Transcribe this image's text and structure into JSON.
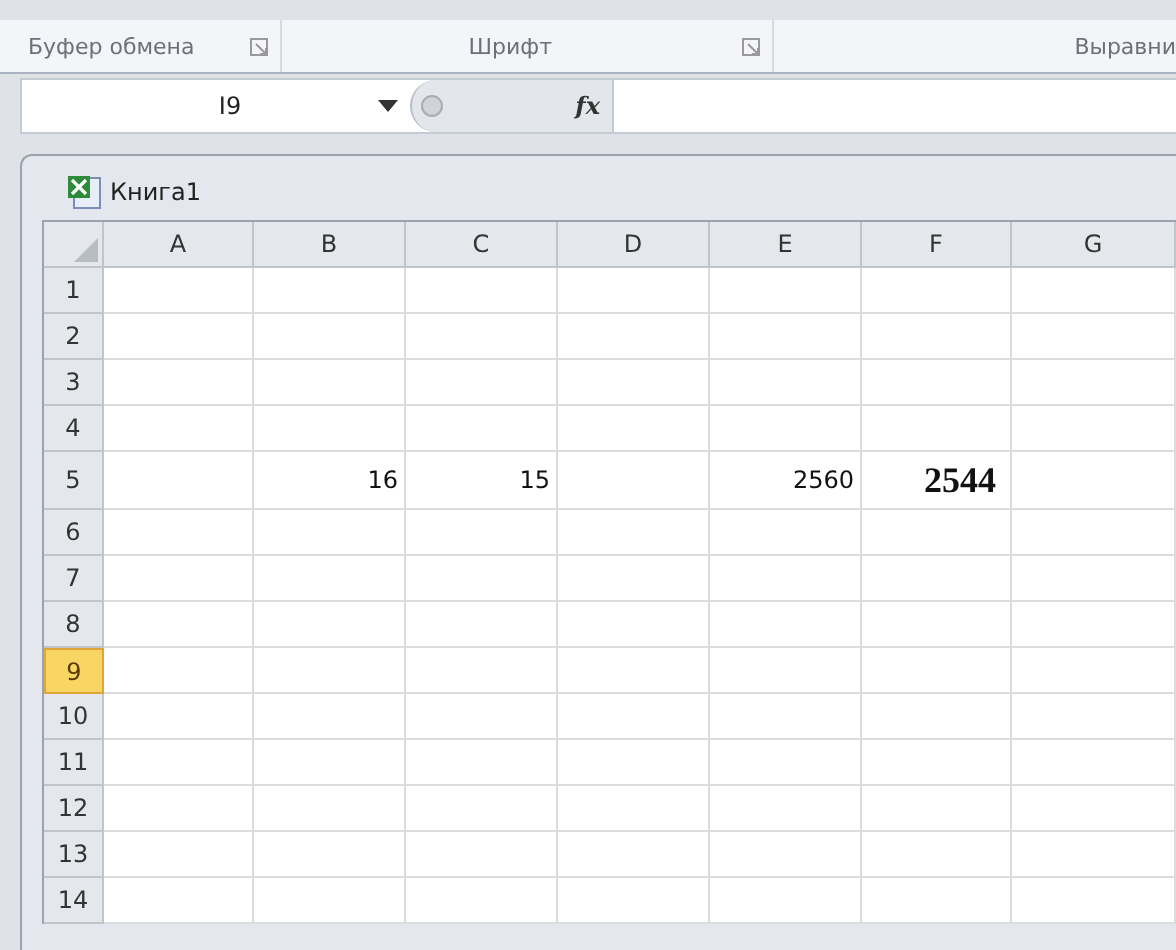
{
  "ribbon_groups": [
    {
      "label": "Буфер обмена",
      "launcher": true
    },
    {
      "label": "Шрифт",
      "launcher": true
    },
    {
      "label": "Выравни",
      "launcher": false
    }
  ],
  "formula_bar": {
    "name_box": "I9",
    "fx": "fx"
  },
  "workbook": {
    "title": "Книга1"
  },
  "columns": [
    {
      "label": "A",
      "selected": false
    },
    {
      "label": "B",
      "selected": false
    },
    {
      "label": "C",
      "selected": false
    },
    {
      "label": "D",
      "selected": false
    },
    {
      "label": "E",
      "selected": false
    },
    {
      "label": "F",
      "selected": false
    },
    {
      "label": "G",
      "selected": false
    }
  ],
  "rows": [
    {
      "header": "1",
      "selected": false,
      "cells": [
        null,
        null,
        null,
        null,
        null,
        null,
        null
      ]
    },
    {
      "header": "2",
      "selected": false,
      "cells": [
        null,
        null,
        null,
        null,
        null,
        null,
        null
      ]
    },
    {
      "header": "3",
      "selected": false,
      "cells": [
        null,
        null,
        null,
        null,
        null,
        null,
        null
      ]
    },
    {
      "header": "4",
      "selected": false,
      "cells": [
        null,
        null,
        null,
        null,
        null,
        null,
        null
      ]
    },
    {
      "header": "5",
      "selected": false,
      "cells": [
        null,
        {
          "text": "16",
          "kind": "plain"
        },
        {
          "text": "15",
          "kind": "plain"
        },
        null,
        {
          "text": "2560",
          "kind": "plain"
        },
        {
          "text": "2544",
          "kind": "bold"
        },
        null
      ]
    },
    {
      "header": "6",
      "selected": false,
      "cells": [
        null,
        null,
        null,
        null,
        null,
        null,
        null
      ]
    },
    {
      "header": "7",
      "selected": false,
      "cells": [
        null,
        null,
        null,
        null,
        null,
        null,
        null
      ]
    },
    {
      "header": "8",
      "selected": false,
      "cells": [
        null,
        null,
        null,
        null,
        null,
        null,
        null
      ]
    },
    {
      "header": "9",
      "selected": true,
      "cells": [
        null,
        null,
        null,
        null,
        null,
        null,
        null
      ]
    },
    {
      "header": "10",
      "selected": false,
      "cells": [
        null,
        null,
        null,
        null,
        null,
        null,
        null
      ]
    },
    {
      "header": "11",
      "selected": false,
      "cells": [
        null,
        null,
        null,
        null,
        null,
        null,
        null
      ]
    },
    {
      "header": "12",
      "selected": false,
      "cells": [
        null,
        null,
        null,
        null,
        null,
        null,
        null
      ]
    },
    {
      "header": "13",
      "selected": false,
      "cells": [
        null,
        null,
        null,
        null,
        null,
        null,
        null
      ]
    },
    {
      "header": "14",
      "selected": false,
      "cells": [
        null,
        null,
        null,
        null,
        null,
        null,
        null
      ]
    }
  ]
}
